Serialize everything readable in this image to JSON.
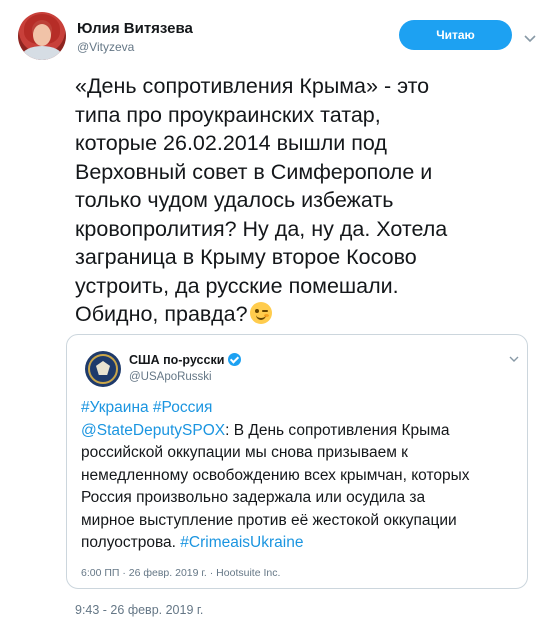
{
  "author": {
    "name": "Юлия Витязева",
    "handle": "@Vityzeva",
    "follow_label": "Читаю"
  },
  "tweet": {
    "lines": [
      "«День сопротивления Крыма» - это",
      "типа про проукраинских татар,",
      "которые 26.02.2014 вышли под",
      "Верховный совет в Симферополе и",
      "только чудом удалось избежать",
      "кровопролития? Ну да, ну да. Хотела",
      "заграница в Крыму второе Косово",
      "устроить, да русские помешали.",
      "Обидно, правда?"
    ],
    "emoji": "winking-face-emoji",
    "timestamp": "9:43 - 26 февр. 2019 г."
  },
  "quoted": {
    "name": "США по-русски",
    "handle": "@USApoRusski",
    "hashtags": "#Украина #Россия",
    "mention": "@StateDeputySPOX",
    "lines": [
      ": В День сопротивления Крыма",
      "российской оккупации мы снова призываем к",
      "немедленному освобождению всех крымчан, которых",
      "Россия произвольно задержала или осудила за",
      "мирное выступление против её жестокой оккупации",
      "полуострова. "
    ],
    "end_hashtag": "#CrimeaisUkraine",
    "meta": "6:00 ПП · 26 февр. 2019 г. · Hootsuite Inc."
  },
  "colors": {
    "accent": "#1da1f2",
    "link": "#1b95e0",
    "secondary_text": "#657786"
  }
}
